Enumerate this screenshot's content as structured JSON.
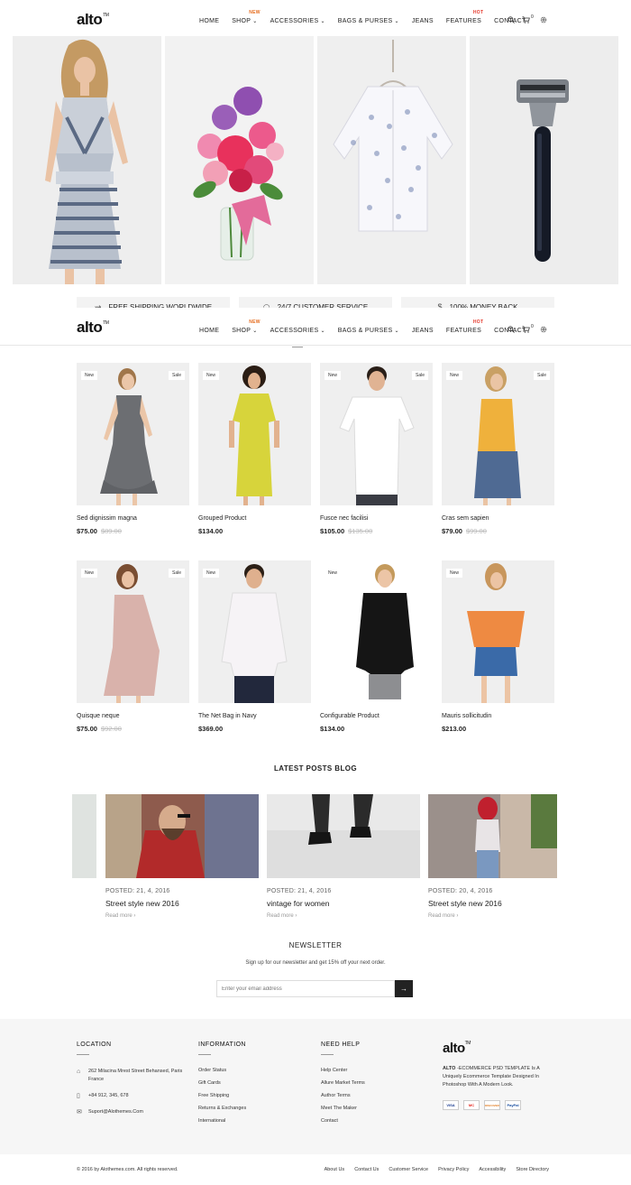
{
  "brand": {
    "logo": "alto",
    "tm": "TM"
  },
  "nav": {
    "items": [
      {
        "label": "HOME",
        "chevron": false,
        "badge": ""
      },
      {
        "label": "SHOP",
        "chevron": true,
        "badge": "NEW"
      },
      {
        "label": "ACCESSORIES",
        "chevron": true,
        "badge": ""
      },
      {
        "label": "BAGS & PURSES",
        "chevron": true,
        "badge": ""
      },
      {
        "label": "JEANS",
        "chevron": false,
        "badge": ""
      },
      {
        "label": "FEATURES",
        "chevron": false,
        "badge": "HOT"
      },
      {
        "label": "CONTACT",
        "chevron": false,
        "badge": ""
      }
    ],
    "cart_count": "0",
    "icons": [
      "search-icon",
      "cart-icon",
      "settings-icon"
    ]
  },
  "hero": {
    "panels": [
      "dress-model",
      "flower-vase",
      "floral-shirt",
      "razor"
    ]
  },
  "features": [
    {
      "icon": "truck-icon",
      "label": "FREE SHIPPING WORLDWIDE"
    },
    {
      "icon": "headset-icon",
      "label": "24/7 CUSTOMER SERVICE"
    },
    {
      "icon": "money-icon",
      "label": "100% MONEY BACK"
    }
  ],
  "products": {
    "row1": [
      {
        "name": "Sed dignissim magna",
        "price": "$75.00",
        "old": "$89.00",
        "new": "New",
        "sale": "Sale",
        "fig": "woman-grey-dress"
      },
      {
        "name": "Grouped Product",
        "price": "$134.00",
        "old": "",
        "new": "New",
        "sale": "",
        "fig": "woman-yellow-dress"
      },
      {
        "name": "Fusce nec facilisi",
        "price": "$105.00",
        "old": "$135.00",
        "new": "New",
        "sale": "Sale",
        "fig": "man-white-polo"
      },
      {
        "name": "Cras sem sapien",
        "price": "$79.00",
        "old": "$99.00",
        "new": "New",
        "sale": "Sale",
        "fig": "woman-denim-skirt"
      }
    ],
    "row2": [
      {
        "name": "Quisque neque",
        "price": "$75.00",
        "old": "$92.00",
        "new": "New",
        "sale": "Sale",
        "fig": "woman-pink-dress"
      },
      {
        "name": "The Net Bag in Navy",
        "price": "$369.00",
        "old": "",
        "new": "New",
        "sale": "",
        "fig": "man-white-shirt"
      },
      {
        "name": "Configurable Product",
        "price": "$134.00",
        "old": "",
        "new": "New",
        "sale": "",
        "fig": "woman-black-jacket"
      },
      {
        "name": "Mauris sollicitudin",
        "price": "$213.00",
        "old": "",
        "new": "New",
        "sale": "",
        "fig": "woman-orange-top"
      }
    ]
  },
  "blog": {
    "title": "LATEST POSTS BLOG",
    "posts": [
      {
        "meta": "POSTED: 21, 4, 2016",
        "title": "Street style new 2016",
        "more": "Read more"
      },
      {
        "meta": "POSTED: 21, 4, 2016",
        "title": "vintage for women",
        "more": "Read more"
      },
      {
        "meta": "POSTED: 20, 4, 2016",
        "title": "Street style new 2016",
        "more": "Read more"
      }
    ]
  },
  "newsletter": {
    "title": "NEWSLETTER",
    "subtitle": "Sign up for our newsletter and get 15% off your next order.",
    "placeholder": "Enter your email address",
    "button": "→"
  },
  "footer": {
    "location": {
      "title": "LOCATION",
      "address": "262 Milacina Mrest Street Behansed, Paris France",
      "phone": "+84 912, 345, 678",
      "email": "Suport@Alothemes.Com"
    },
    "information": {
      "title": "INFORMATION",
      "links": [
        "Order Status",
        "Gift Cards",
        "Free Shipping",
        "Returns & Exchanges",
        "International"
      ]
    },
    "help": {
      "title": "NEED HELP",
      "links": [
        "Help Center",
        "Allure Market Terms",
        "Author Terms",
        "Meet The Maker",
        "Contact"
      ]
    },
    "about": {
      "logo": "alto",
      "tm": "TM",
      "strong": "ALTO",
      "desc": " -ECOMMERCE PSD TEMPLATE Is A Uniquely Ecommerce Template Designed In Photoshop With A Modern Look.",
      "payments": [
        "VISA",
        "MC",
        "DISCOVER",
        "PayPal"
      ]
    }
  },
  "bottom": {
    "copyright": "© 2016 by Alothemes.com. All rights reserved.",
    "links": [
      "About Us",
      "Contact Us",
      "Customer Service",
      "Privacy Policy",
      "Accessibility",
      "Store Directory"
    ]
  }
}
